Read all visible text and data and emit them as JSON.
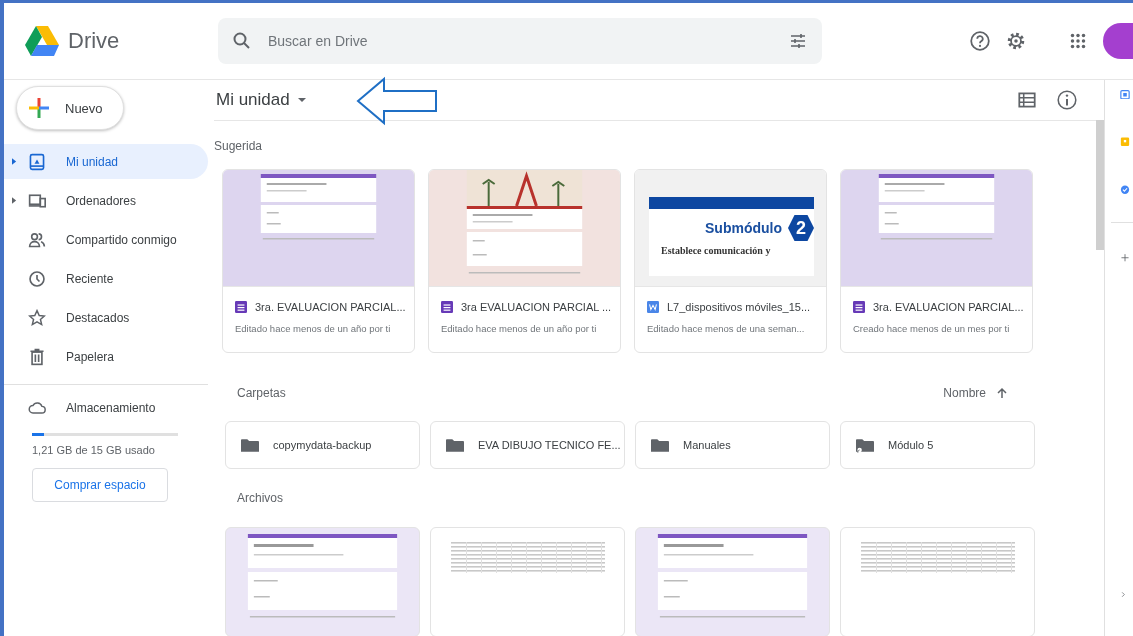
{
  "app": {
    "name": "Drive"
  },
  "search": {
    "placeholder": "Buscar en Drive"
  },
  "new_button": {
    "label": "Nuevo"
  },
  "sidebar": {
    "items": [
      {
        "label": "Mi unidad",
        "selected": true,
        "expandable": true,
        "kind": "drive"
      },
      {
        "label": "Ordenadores",
        "selected": false,
        "expandable": true,
        "kind": "computer"
      },
      {
        "label": "Compartido conmigo",
        "selected": false,
        "expandable": false,
        "kind": "shared"
      },
      {
        "label": "Reciente",
        "selected": false,
        "expandable": false,
        "kind": "recent"
      },
      {
        "label": "Destacados",
        "selected": false,
        "expandable": false,
        "kind": "starred"
      },
      {
        "label": "Papelera",
        "selected": false,
        "expandable": false,
        "kind": "trash"
      }
    ]
  },
  "storage": {
    "label": "Almacenamiento",
    "level": 0.08,
    "usage": "1,21 GB de 15 GB usado",
    "button": "Comprar espacio"
  },
  "location": {
    "title": "Mi unidad"
  },
  "suggested": {
    "heading": "Sugerida",
    "files": [
      {
        "kind": "form",
        "thumbnail": {
          "kind": "form"
        },
        "name": "3ra. EVALUACION PARCIAL...",
        "detail": "Editado hace menos de un año por ti"
      },
      {
        "kind": "form",
        "thumbnail": {
          "kind": "form_banner"
        },
        "name": "3ra EVALUACION PARCIAL ...",
        "detail": "Editado hace menos de un año por ti"
      },
      {
        "kind": "word",
        "thumbnail": {
          "kind": "slide"
        },
        "name": "L7_dispositivos móviles_15...",
        "detail": "Editado hace menos de una seman...",
        "slide": {
          "title": "Submódulo",
          "number": "2",
          "subtitle": "Establece comunicación y"
        }
      },
      {
        "kind": "form",
        "thumbnail": {
          "kind": "form"
        },
        "name": "3ra. EVALUACION PARCIAL...",
        "detail": "Creado hace menos de un mes por ti"
      }
    ]
  },
  "folders": {
    "heading": "Carpetas",
    "sort": "Nombre",
    "items": [
      {
        "kind": "folder",
        "name": "copymydata-backup"
      },
      {
        "kind": "folder",
        "name": "EVA DIBUJO TECNICO FE..."
      },
      {
        "kind": "folder",
        "name": "Manuales"
      },
      {
        "kind": "shared_folder",
        "name": "Módulo 5"
      }
    ]
  },
  "files": {
    "heading": "Archivos",
    "items": [
      {
        "kind": "form"
      },
      {
        "kind": "sheet"
      },
      {
        "kind": "form"
      },
      {
        "kind": "sheet"
      }
    ]
  }
}
